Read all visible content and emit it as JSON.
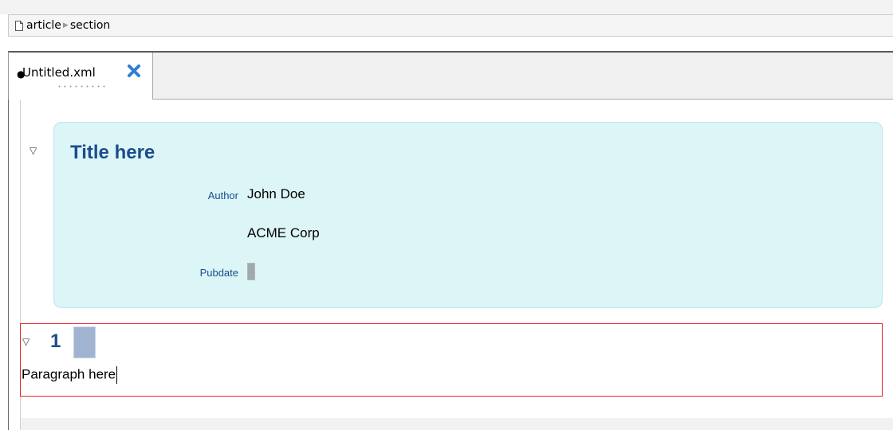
{
  "breadcrumb": {
    "items": [
      "article",
      "section"
    ]
  },
  "tabs": [
    {
      "label": "Untitled.xml",
      "modified_marker": "●"
    }
  ],
  "document": {
    "title": "Title here",
    "author_label": "Author",
    "author_name": "John Doe",
    "affiliation": "ACME Corp",
    "pubdate_label": "Pubdate",
    "section_number": "1",
    "paragraph": "Paragraph here"
  },
  "icons": {
    "collapse": "triangle-down-icon",
    "close": "close-x-icon",
    "file": "document-icon"
  },
  "colors": {
    "heading": "#1b4d8c",
    "info_bg": "#dcf5f7",
    "section_border": "#e0242a",
    "close_icon": "#2f7fd2"
  }
}
